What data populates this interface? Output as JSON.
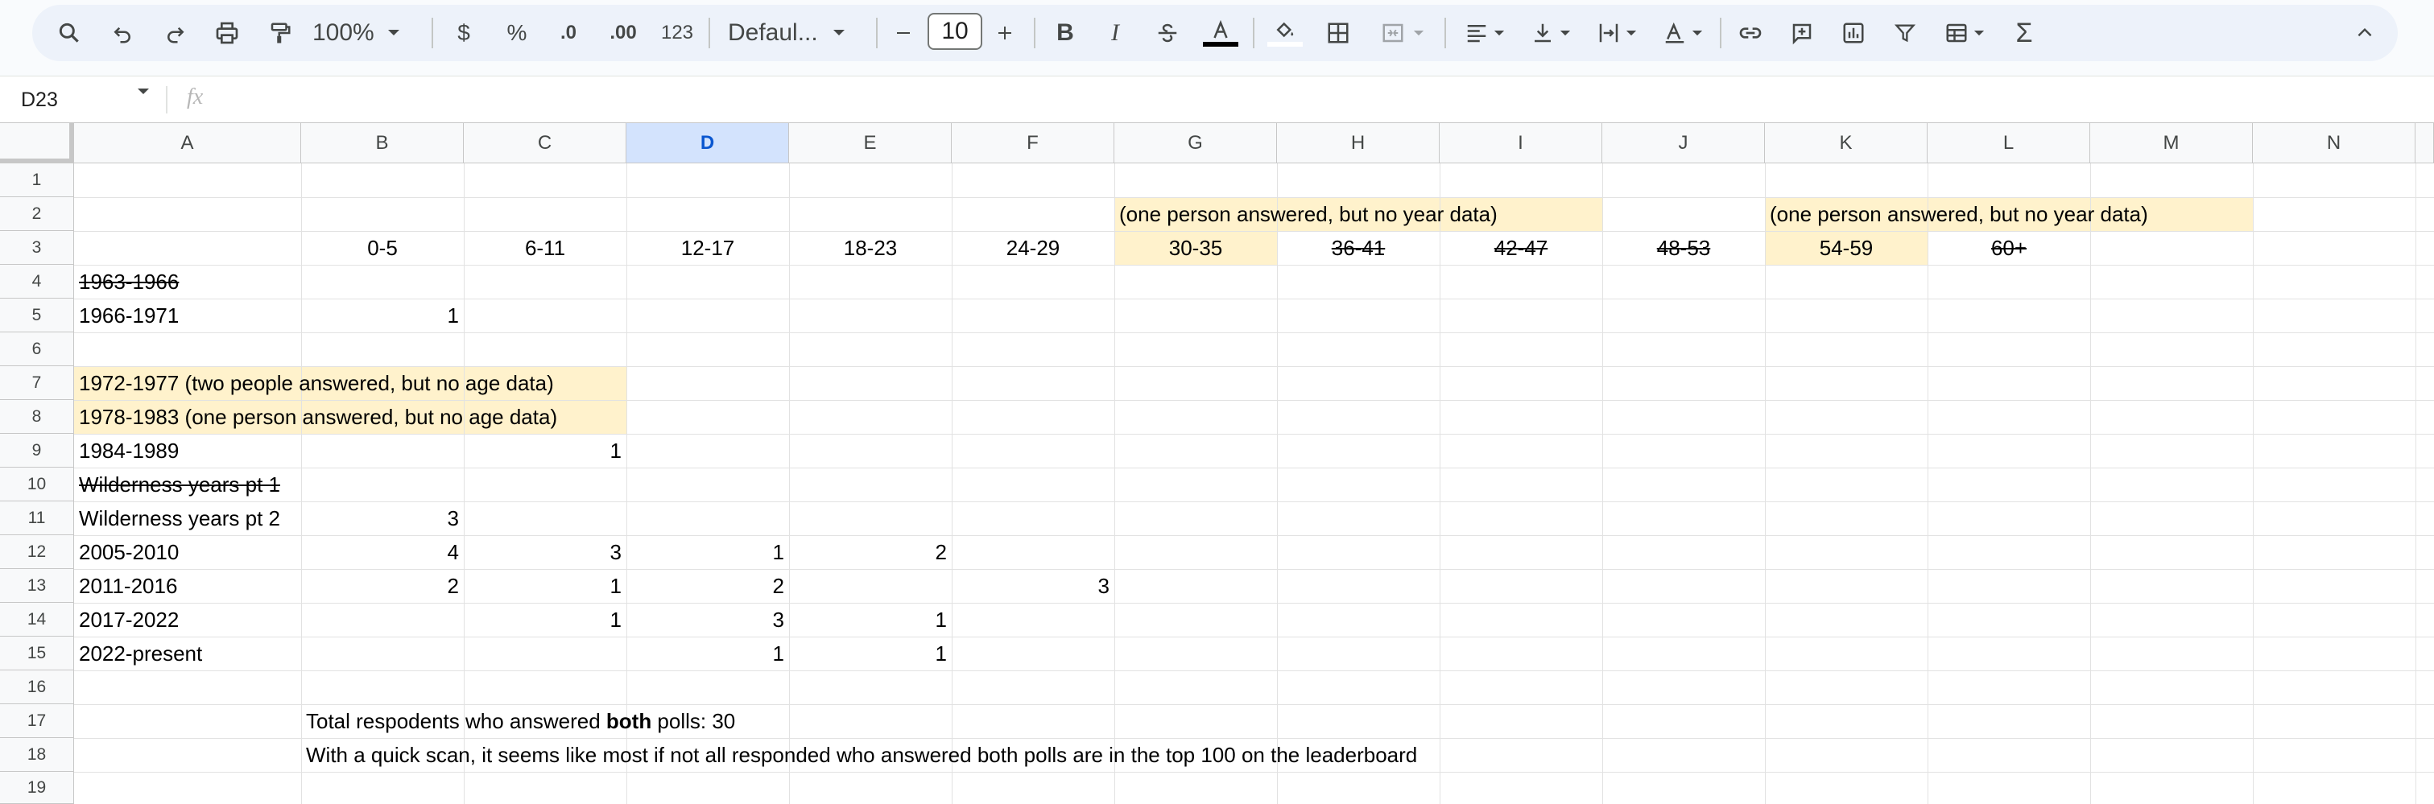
{
  "toolbar": {
    "zoom": "100%",
    "currency": "$",
    "percent": "%",
    "decrease_decimal": ".0",
    "increase_decimal": ".00",
    "number_format": "123",
    "font_name": "Defaul...",
    "font_size": "10"
  },
  "formula_bar": {
    "name_box": "D23",
    "fx_label": "fx",
    "formula": ""
  },
  "columns": [
    "A",
    "B",
    "C",
    "D",
    "E",
    "F",
    "G",
    "H",
    "I",
    "J",
    "K",
    "L",
    "M",
    "N"
  ],
  "selected_column": "D",
  "rows": [
    "1",
    "2",
    "3",
    "4",
    "5",
    "6",
    "7",
    "8",
    "9",
    "10",
    "11",
    "12",
    "13",
    "14",
    "15",
    "16",
    "17",
    "18",
    "19"
  ],
  "sheet": {
    "g2": "(one person answered, but no year data)",
    "k2": "(one person answered, but no year data)",
    "b3": "0-5",
    "c3": "6-11",
    "d3": "12-17",
    "e3": "18-23",
    "f3": "24-29",
    "g3": "30-35",
    "h3": "36-41",
    "i3": "42-47",
    "j3": "48-53",
    "k3": "54-59",
    "l3": "60+",
    "a4": "1963-1966",
    "a5": "1966-1971",
    "b5": "1",
    "a6": "1972-1977 (two people answered, but no age data)",
    "a7": "1978-1983 (one person answered, but no age data)",
    "a8": "1984-1989",
    "c8": "1",
    "a9": "Wilderness years pt 1",
    "a10": "Wilderness years pt 2",
    "b10": "3",
    "a11": "2005-2010",
    "b11": "4",
    "c11": "3",
    "d11": "1",
    "e11": "2",
    "a12": "2011-2016",
    "b12": "2",
    "c12": "1",
    "d12": "2",
    "f12": "3",
    "a13": "2017-2022",
    "c13": "1",
    "d13": "3",
    "e13": "1",
    "a14": "2022-present",
    "d14": "1",
    "e14": "1",
    "b17_pre": "Total respodents who answered ",
    "b17_bold": "both",
    "b17_post": " polls: 30",
    "b18": "With a quick scan, it seems like most if not all responded who answered both polls are in the top 100 on the leaderboard"
  },
  "colors": {
    "highlight": "#fff2cc",
    "selected_header": "#d3e3fd",
    "toolbar_bg": "#edf2fa"
  }
}
